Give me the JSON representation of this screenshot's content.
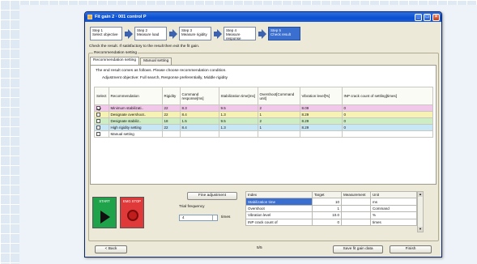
{
  "window": {
    "title": "Fit gain 2 · 001 control P"
  },
  "steps": [
    {
      "num": "Step 1",
      "label": "Select objective"
    },
    {
      "num": "Step 2",
      "label": "Measure load"
    },
    {
      "num": "Step 3",
      "label": "Measure rigidity"
    },
    {
      "num": "Step 4",
      "label": "Measure response"
    },
    {
      "num": "Step 5",
      "label": "Check result"
    }
  ],
  "instruction": "Check the result. If satisfactory to the result then exit the fit gain.",
  "group_title": "Recommendation setting",
  "tabs": [
    "Recommendation setting",
    "Manual setting"
  ],
  "panel": {
    "line1": "The end result comes as follows. Please choose recommendation condition.",
    "line2": "Adjustment objective: Full search, Response preferentially, Middle rigidity"
  },
  "rec_table": {
    "headers": [
      "Select",
      "Recommendation",
      "Rigidity",
      "Command response[ms]",
      "Stabilization time[ms]",
      "Overshoot[Command unit]",
      "Vibration level[%]",
      "INP crack count of settling[times]"
    ],
    "rows": [
      {
        "checked": true,
        "name": "Minimum stabilizati..",
        "rigidity": "22",
        "cmd": "8.3",
        "stab": "9.5",
        "over": "2",
        "vib": "8.09",
        "inp": "0"
      },
      {
        "checked": false,
        "name": "Designate overshoot..",
        "rigidity": "22",
        "cmd": "8.4",
        "stab": "1.3",
        "over": "1",
        "vib": "8.29",
        "inp": "0"
      },
      {
        "checked": false,
        "name": "Designate stabiliz..",
        "rigidity": "18",
        "cmd": "1.5",
        "stab": "9.5",
        "over": "2",
        "vib": "8.29",
        "inp": "0"
      },
      {
        "checked": false,
        "name": "High rigidity setting",
        "rigidity": "22",
        "cmd": "8.4",
        "stab": "1.3",
        "over": "1",
        "vib": "8.29",
        "inp": "0"
      },
      {
        "checked": false,
        "name": "Manual setting",
        "rigidity": "",
        "cmd": "",
        "stab": "",
        "over": "",
        "vib": "",
        "inp": ""
      }
    ]
  },
  "controls": {
    "start": "START",
    "stop": "EMG STOP",
    "fine_adjustment": "Fine adjustment",
    "trial_label": "Trial frequency",
    "trial_value": "4",
    "times": "times"
  },
  "index_table": {
    "headers": [
      "Index",
      "Target",
      "Measurement",
      "Unit"
    ],
    "rows": [
      {
        "name": "Stabilization time",
        "target": "10",
        "meas": "",
        "unit": "ms"
      },
      {
        "name": "Overshoot",
        "target": "1",
        "meas": "",
        "unit": "Command"
      },
      {
        "name": "Vibration level",
        "target": "10.0",
        "meas": "",
        "unit": "%"
      },
      {
        "name": "INP crack count of",
        "target": "0",
        "meas": "",
        "unit": "times"
      }
    ]
  },
  "footer": {
    "back": "< Back",
    "page": "5/5",
    "save": "Save fit gain data",
    "finish": "Finish"
  }
}
